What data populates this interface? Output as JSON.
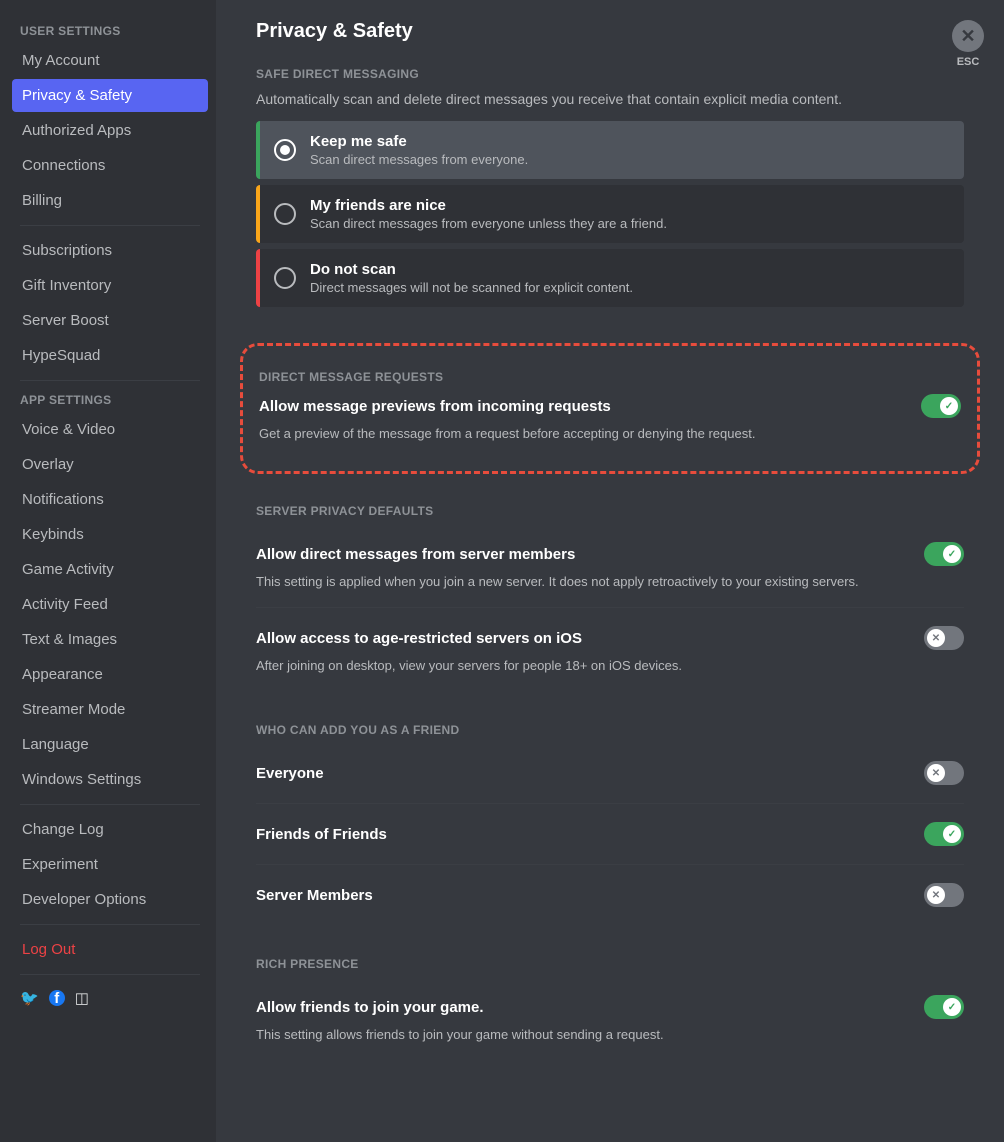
{
  "sidebar": {
    "sections": [
      {
        "header": "USER SETTINGS",
        "items": [
          "My Account",
          "Privacy & Safety",
          "Authorized Apps",
          "Connections",
          "Billing"
        ]
      },
      {
        "header": null,
        "items": [
          "Subscriptions",
          "Gift Inventory",
          "Server Boost",
          "HypeSquad"
        ]
      },
      {
        "header": "APP SETTINGS",
        "items": [
          "Voice & Video",
          "Overlay",
          "Notifications",
          "Keybinds",
          "Game Activity",
          "Activity Feed",
          "Text & Images",
          "Appearance",
          "Streamer Mode",
          "Language",
          "Windows Settings"
        ]
      },
      {
        "header": null,
        "items": [
          "Change Log",
          "Experiment",
          "Developer Options"
        ]
      },
      {
        "header": null,
        "items": [
          "Log Out"
        ]
      }
    ],
    "activeItem": "Privacy & Safety",
    "logoutItem": "Log Out"
  },
  "esc": {
    "label": "ESC"
  },
  "page": {
    "title": "Privacy & Safety"
  },
  "safeDM": {
    "header": "SAFE DIRECT MESSAGING",
    "desc": "Automatically scan and delete direct messages you receive that contain explicit media content.",
    "options": [
      {
        "title": "Keep me safe",
        "sub": "Scan direct messages from everyone.",
        "selected": true
      },
      {
        "title": "My friends are nice",
        "sub": "Scan direct messages from everyone unless they are a friend.",
        "selected": false
      },
      {
        "title": "Do not scan",
        "sub": "Direct messages will not be scanned for explicit content.",
        "selected": false
      }
    ]
  },
  "dmRequests": {
    "header": "DIRECT MESSAGE REQUESTS",
    "title": "Allow message previews from incoming requests",
    "desc": "Get a preview of the message from a request before accepting or denying the request.",
    "on": true
  },
  "serverPrivacy": {
    "header": "SERVER PRIVACY DEFAULTS",
    "rows": [
      {
        "title": "Allow direct messages from server members",
        "desc": "This setting is applied when you join a new server. It does not apply retroactively to your existing servers.",
        "on": true
      },
      {
        "title": "Allow access to age-restricted servers on iOS",
        "desc": "After joining on desktop, view your servers for people 18+ on iOS devices.",
        "on": false
      }
    ]
  },
  "friendAdd": {
    "header": "WHO CAN ADD YOU AS A FRIEND",
    "rows": [
      {
        "title": "Everyone",
        "on": false
      },
      {
        "title": "Friends of Friends",
        "on": true
      },
      {
        "title": "Server Members",
        "on": false
      }
    ]
  },
  "richPresence": {
    "header": "RICH PRESENCE",
    "title": "Allow friends to join your game.",
    "desc": "This setting allows friends to join your game without sending a request.",
    "on": true
  }
}
